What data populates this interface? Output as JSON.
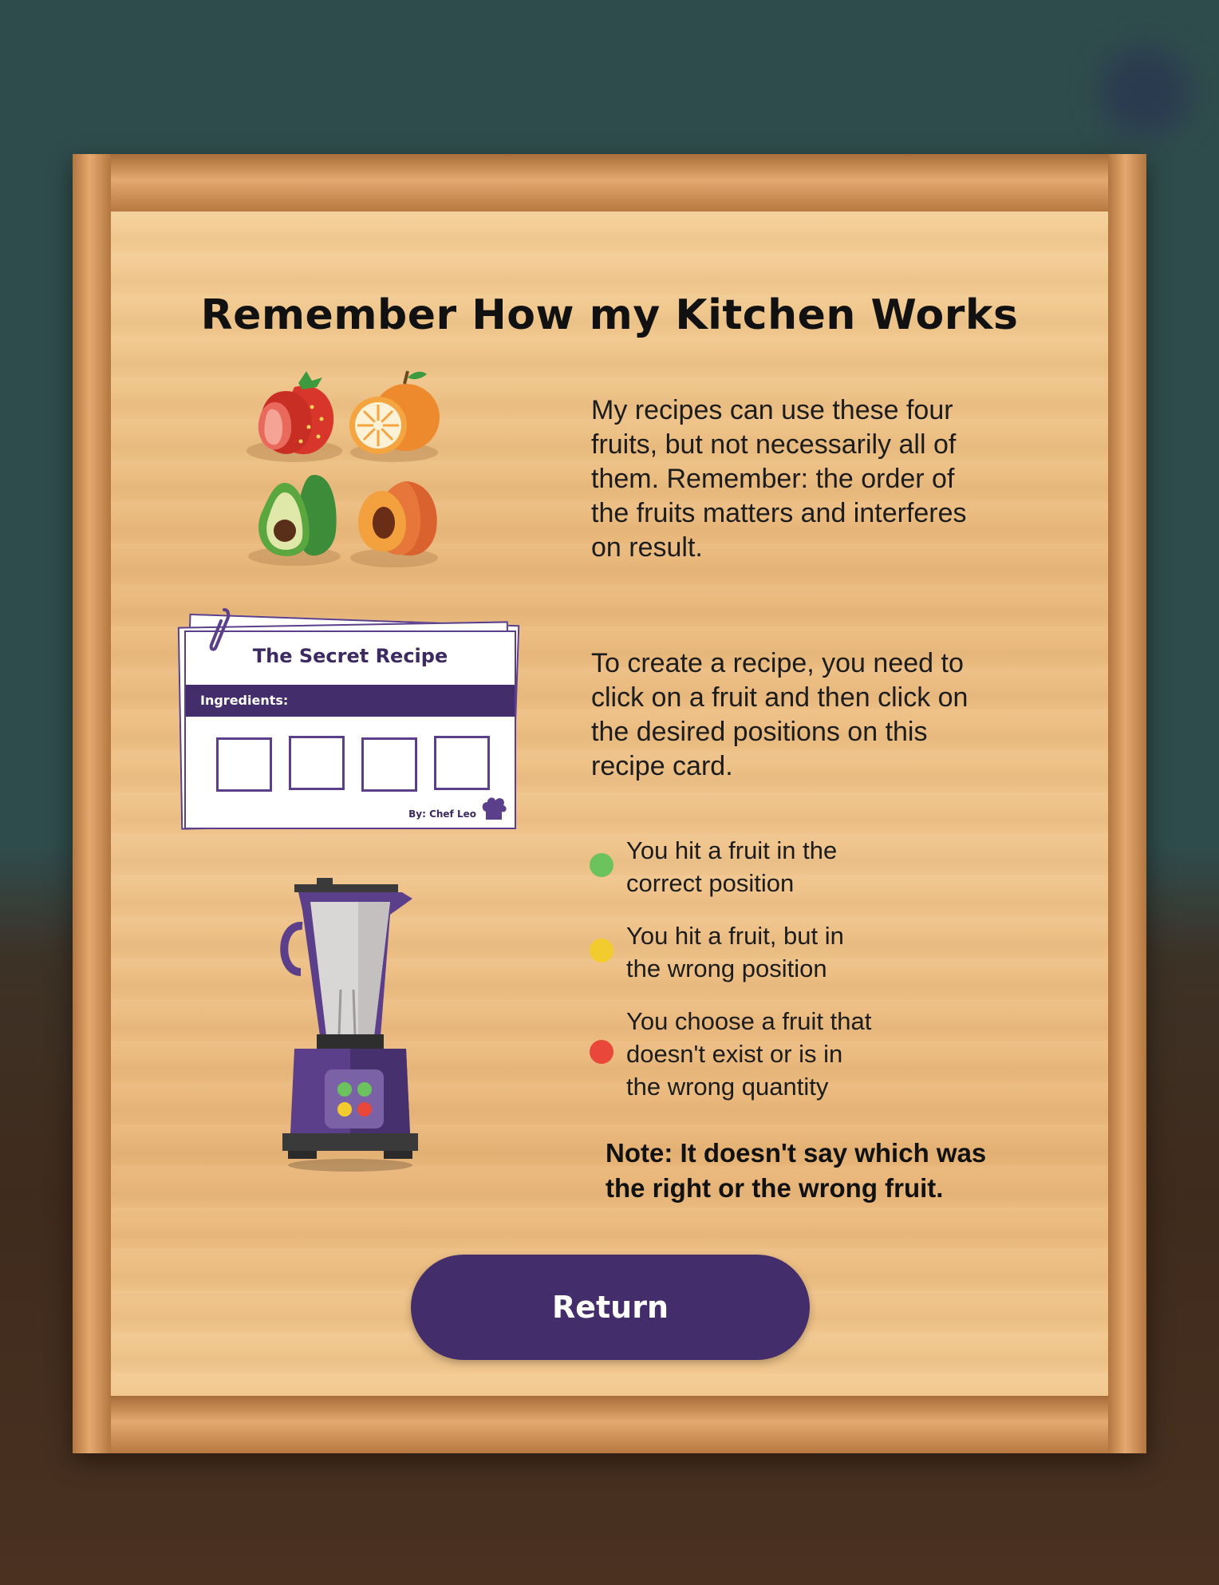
{
  "title": "Remember How my Kitchen Works",
  "fruits": {
    "icons": [
      "strawberry-icon",
      "orange-icon",
      "avocado-icon",
      "peach-icon"
    ],
    "description": [
      "My recipes can use these four",
      "fruits, but not necessarily all of",
      "them. Remember: the order of",
      "the fruits matters and interferes",
      "on result."
    ]
  },
  "recipe_card": {
    "title": "The Secret Recipe",
    "ingredients_label": "Ingredients:",
    "author": "By: Chef Leo",
    "slots": 4,
    "description": [
      "To create a recipe, you need to",
      "click on a fruit and then click on",
      "the desired positions on this",
      "recipe card."
    ]
  },
  "legend": [
    {
      "color": "#6cc35e",
      "lines": [
        "You hit a fruit in the",
        "correct position"
      ]
    },
    {
      "color": "#f2cc2f",
      "lines": [
        "You hit a fruit, but in",
        "the wrong position"
      ]
    },
    {
      "color": "#e8473a",
      "lines": [
        "You choose a fruit that",
        "doesn't exist or is in",
        "the wrong quantity"
      ]
    }
  ],
  "note": [
    "Note: It doesn't say which was",
    "the right or the wrong fruit."
  ],
  "return_label": "Return",
  "colors": {
    "accent": "#432d6a",
    "wood_light": "#f4cf97",
    "wood_frame": "#c9894f"
  }
}
